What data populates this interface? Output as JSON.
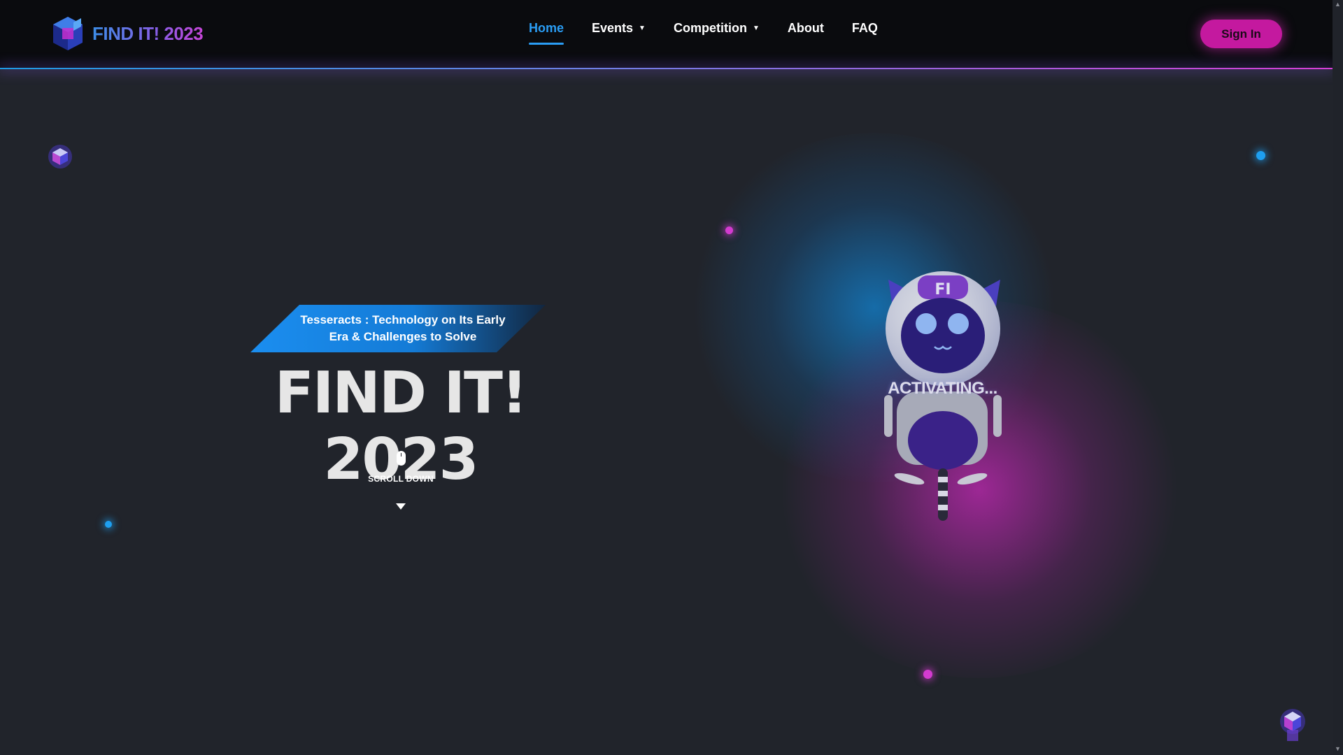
{
  "brand": {
    "name": "FIND IT! 2023",
    "logo_icon": "cube-logo-icon"
  },
  "nav": {
    "items": [
      {
        "label": "Home",
        "active": true,
        "dropdown": false
      },
      {
        "label": "Events",
        "active": false,
        "dropdown": true
      },
      {
        "label": "Competition",
        "active": false,
        "dropdown": true
      },
      {
        "label": "About",
        "active": false,
        "dropdown": false
      },
      {
        "label": "FAQ",
        "active": false,
        "dropdown": false
      }
    ],
    "sign_in_label": "Sign In"
  },
  "hero": {
    "tagline": "Tesseracts : Technology on Its Early Era & Challenges to Solve",
    "title": "FIND IT! 2023",
    "scroll_label": "SCROLL DOWN"
  },
  "mascot": {
    "badge": "FI",
    "status": "ACTIVATING..."
  },
  "colors": {
    "accent_blue": "#2a9df4",
    "accent_pink": "#c4199f",
    "background": "#21242b",
    "navbar": "#0a0b0e"
  }
}
